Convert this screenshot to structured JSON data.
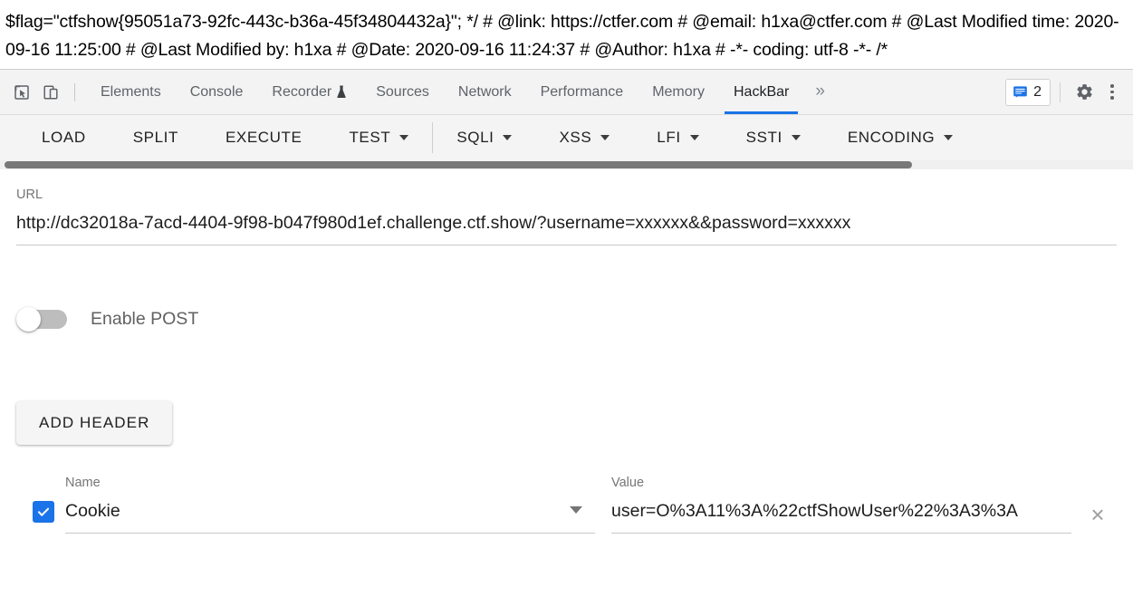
{
  "page_source_text": "$flag=\"ctfshow{95051a73-92fc-443c-b36a-45f34804432a}\"; */ # @link: https://ctfer.com # @email: h1xa@ctfer.com # @Last Modified time: 2020-09-16 11:25:00 # @Last Modified by: h1xa # @Date: 2020-09-16 11:24:37 # @Author: h1xa # -*- coding: utf-8 -*- /*",
  "devtools": {
    "inspect_icon": "inspect-element-icon",
    "device_icon": "device-toolbar-icon",
    "tabs": [
      {
        "label": "Elements",
        "active": false
      },
      {
        "label": "Console",
        "active": false
      },
      {
        "label": "Recorder",
        "active": false,
        "icon": "flask-icon"
      },
      {
        "label": "Sources",
        "active": false
      },
      {
        "label": "Network",
        "active": false
      },
      {
        "label": "Performance",
        "active": false
      },
      {
        "label": "Memory",
        "active": false
      },
      {
        "label": "HackBar",
        "active": true
      }
    ],
    "more_tabs_label": "»",
    "message_count": "2",
    "message_icon": "message-icon",
    "settings_icon": "gear-icon",
    "more_options_icon": "kebab-menu-icon",
    "accent_color": "#1a73e8"
  },
  "hackbar": {
    "menu": [
      {
        "label": "LOAD",
        "has_caret": false
      },
      {
        "label": "SPLIT",
        "has_caret": false
      },
      {
        "label": "EXECUTE",
        "has_caret": false
      },
      {
        "label": "TEST",
        "has_caret": true
      },
      {
        "label": "SQLI",
        "has_caret": true
      },
      {
        "label": "XSS",
        "has_caret": true
      },
      {
        "label": "LFI",
        "has_caret": true
      },
      {
        "label": "SSTI",
        "has_caret": true
      },
      {
        "label": "ENCODING",
        "has_caret": true
      }
    ],
    "url_field": {
      "label": "URL",
      "value": "http://dc32018a-7acd-4404-9f98-b047f980d1ef.challenge.ctf.show/?username=xxxxxx&&password=xxxxxx",
      "placeholder": "URL"
    },
    "post_toggle": {
      "label": "Enable POST",
      "enabled": false
    },
    "add_header_label": "ADD HEADER",
    "headers_columns": {
      "name": "Name",
      "value": "Value"
    },
    "headers": [
      {
        "enabled": true,
        "name": "Cookie",
        "name_placeholder": "Name",
        "value": "user=O%3A11%3A%22ctfShowUser%22%3A3%3A",
        "value_placeholder": "Value",
        "remove_label": "×"
      }
    ]
  }
}
